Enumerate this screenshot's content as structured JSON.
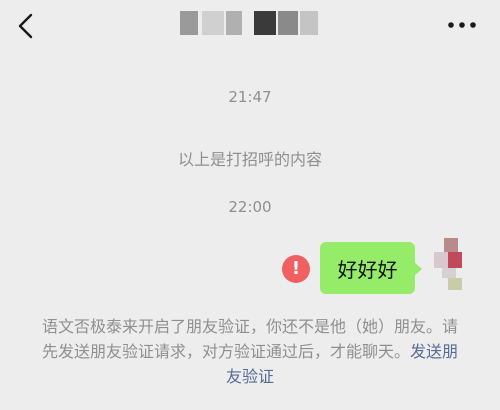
{
  "header": {
    "back_icon": "chevron-left-icon",
    "title": "",
    "more_icon": "more-dots-icon"
  },
  "chat": {
    "time_1": "21:47",
    "greeting_note": "以上是打招呼的内容",
    "time_2": "22:00",
    "message": {
      "text": "好好好",
      "status_icon": "error-icon",
      "status_glyph": "!",
      "bubble_color": "#95ec69",
      "status_color": "#f06060"
    },
    "notice": {
      "text": "语文否极泰来开启了朋友验证，你还不是他（她）朋友。请先发送朋友验证请求，对方验证通过后，才能聊天。",
      "link": "发送朋友验证",
      "link_color": "#576b95"
    }
  }
}
